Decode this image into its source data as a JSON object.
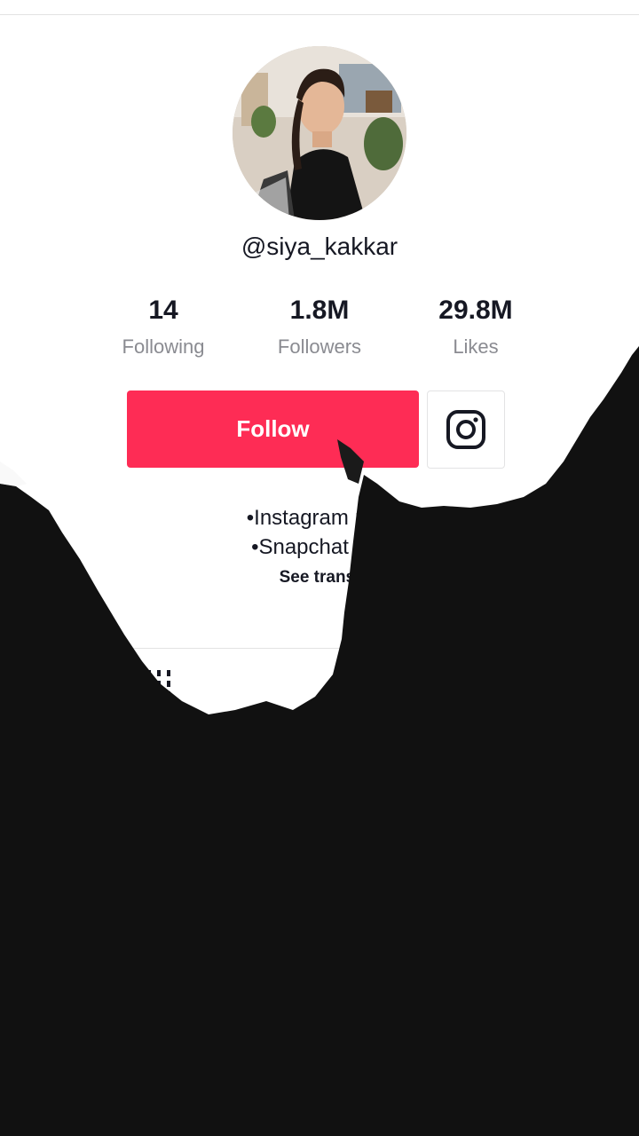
{
  "profile": {
    "username": "@siya_kakkar",
    "avatar_icon": "profile-photo"
  },
  "stats": {
    "following": {
      "value": "14",
      "label": "Following"
    },
    "followers": {
      "value": "1.8M",
      "label": "Followers"
    },
    "likes": {
      "value": "29.8M",
      "label": "Likes"
    }
  },
  "actions": {
    "follow_label": "Follow",
    "instagram_icon": "instagram-icon"
  },
  "bio": {
    "line1": "•Instagram : siy",
    "line2": "•Snapchat : sk",
    "translate_label": "See transl"
  },
  "tabs": {
    "grid_icon": "video-grid-icon"
  },
  "colors": {
    "accent": "#fe2c55",
    "text": "#161823",
    "muted": "#8a8b91",
    "ink": "#111111"
  }
}
